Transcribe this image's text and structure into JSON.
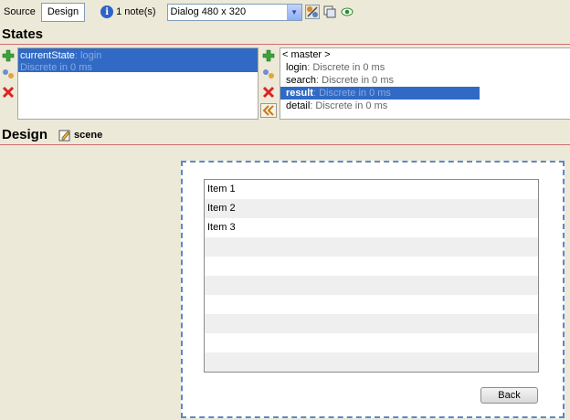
{
  "toolbar": {
    "source_label": "Source",
    "design_label": "Design",
    "notes_label": "1 note(s)",
    "dialog_select": "Dialog 480 x 320",
    "icons": [
      "info-icon",
      "dropdown-arrow-icon",
      "tools-icon",
      "window-icon",
      "eye-icon"
    ]
  },
  "states_header": "States",
  "states": {
    "current": {
      "name": "currentState",
      "value": ": login",
      "transition": "Discrete in 0 ms"
    },
    "list": [
      {
        "name": "< master >",
        "transition": ""
      },
      {
        "name": "login",
        "transition": ": Discrete in 0 ms"
      },
      {
        "name": "search",
        "transition": ": Discrete in 0 ms"
      },
      {
        "name": "result",
        "transition": ": Discrete in 0 ms",
        "selected": true
      },
      {
        "name": "detail",
        "transition": ": Discrete in 0 ms"
      }
    ]
  },
  "design_header": "Design",
  "scene_label": "scene",
  "dialog": {
    "items": [
      "Item 1",
      "Item 2",
      "Item 3",
      "",
      "",
      "",
      "",
      "",
      "",
      ""
    ],
    "back_label": "Back"
  },
  "colors": {
    "selection": "#316ac5",
    "dialog_border": "#5b89c8",
    "header_line": "#cf6f6f",
    "background": "#ece9d8"
  }
}
